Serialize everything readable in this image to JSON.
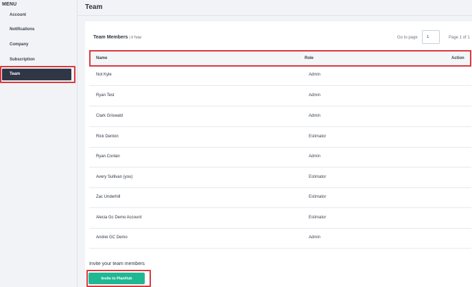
{
  "sidebar": {
    "menu_title": "MENU",
    "items": [
      {
        "label": "Account"
      },
      {
        "label": "Notifications"
      },
      {
        "label": "Company"
      },
      {
        "label": "Subscription"
      },
      {
        "label": "Team",
        "active": true
      }
    ]
  },
  "header": {
    "title": "Team"
  },
  "members": {
    "title": "Team Members",
    "total": "| 9 Total",
    "pagination": {
      "goto_label": "Go to page",
      "page_value": "1",
      "page_of": "Page 1 of 1"
    },
    "columns": {
      "name": "Name",
      "role": "Role",
      "action": "Action"
    },
    "rows": [
      {
        "name": "Not Kyle",
        "role": "Admin"
      },
      {
        "name": "Ryan Test",
        "role": "Admin"
      },
      {
        "name": "Clark Griswald",
        "role": "Admin"
      },
      {
        "name": "Rick Denton",
        "role": "Estimator"
      },
      {
        "name": "Ryan Conlan",
        "role": "Admin"
      },
      {
        "name": "Avery Sullivan (you)",
        "role": "Estimator"
      },
      {
        "name": "Zac Underhill",
        "role": "Estimator"
      },
      {
        "name": "Alecia Gc Demo Account",
        "role": "Estimator"
      },
      {
        "name": "Andrei GC Demo",
        "role": "Admin"
      }
    ]
  },
  "invite": {
    "title": "Invite your team members",
    "button_label": "Invite to PlanHub"
  },
  "colors": {
    "highlight": "#d9363e",
    "active_nav": "#2f3746",
    "invite_button": "#1fb893"
  }
}
